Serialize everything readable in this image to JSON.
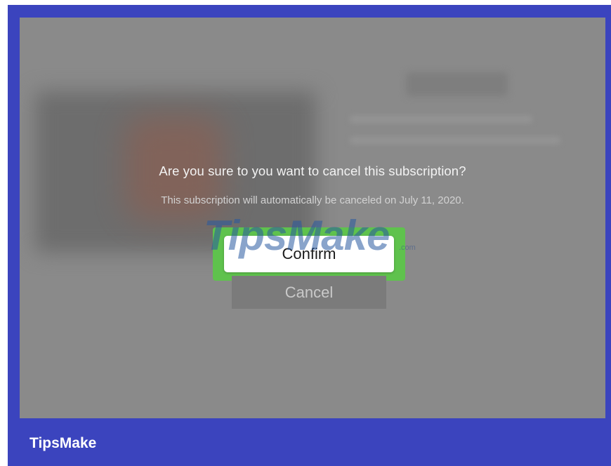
{
  "dialog": {
    "title": "Are you sure to you want to cancel this subscription?",
    "message": "This subscription will automatically be canceled on July 11, 2020.",
    "confirm_label": "Confirm",
    "cancel_label": "Cancel"
  },
  "watermark": {
    "text": "TipsMake",
    "suffix": ".com"
  },
  "footer": {
    "brand": "TipsMake"
  },
  "colors": {
    "frame": "#3b44be",
    "screen": "#8a8a8a",
    "focus_highlight": "#5fc24d",
    "confirm_bg": "#ffffff"
  }
}
